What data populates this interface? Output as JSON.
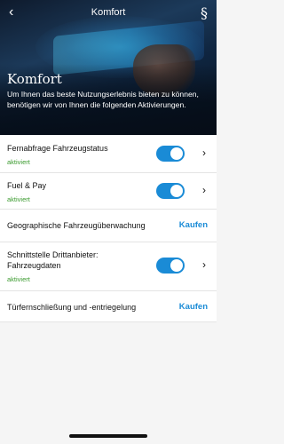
{
  "header": {
    "title": "Komfort",
    "back_glyph": "‹",
    "legal_glyph": "§",
    "back_icon": "chevron-left-icon",
    "legal_icon": "paragraph-icon"
  },
  "hero": {
    "title": "Komfort",
    "description": "Um Ihnen das beste Nutzungserlebnis bieten zu können, benötigen wir von Ihnen die folgenden Aktivierungen."
  },
  "items": [
    {
      "label": "Fernabfrage Fahrzeugstatus",
      "status": "aktiviert",
      "toggle_on": true
    },
    {
      "label": "Fuel & Pay",
      "status": "aktiviert",
      "toggle_on": true
    },
    {
      "label": "Geographische Fahrzeugüberwachung",
      "action": "Kaufen"
    },
    {
      "label": "Schnittstelle Drittanbieter: Fahrzeugdaten",
      "status": "aktiviert",
      "toggle_on": true
    },
    {
      "label": "Türfernschließung und -entriegelung",
      "action": "Kaufen"
    }
  ],
  "chevron_glyph": "›",
  "colors": {
    "accent": "#1a8bd6",
    "status_green": "#3a9a2e"
  }
}
